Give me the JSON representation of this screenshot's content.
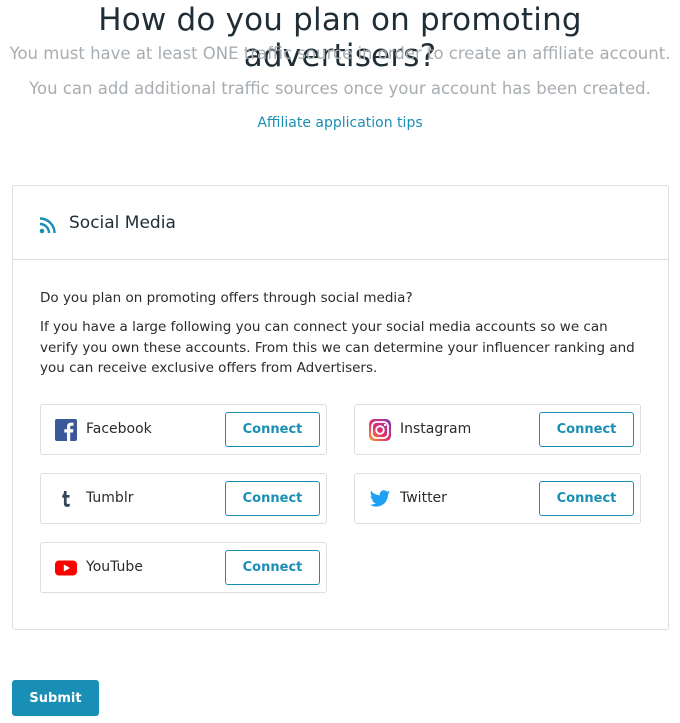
{
  "header": {
    "title": "How do you plan on promoting advertisers?",
    "subtitle_1": "You must have at least ONE traffic source in order to create an affiliate account.",
    "subtitle_2": "You can add additional traffic sources once your account has been created.",
    "tips_link": "Affiliate application tips"
  },
  "panel": {
    "title": "Social Media",
    "icon": "rss-icon",
    "question": "Do you plan on promoting offers through social media?",
    "description": "If you have a large following you can connect your social media accounts so we can verify you own these accounts. From this we can determine your influencer ranking and you can receive exclusive offers from Advertisers.",
    "networks": [
      {
        "label": "Facebook",
        "icon": "facebook-icon",
        "button": "Connect",
        "color": "#3b5998"
      },
      {
        "label": "Instagram",
        "icon": "instagram-icon",
        "button": "Connect",
        "color": "#c13584"
      },
      {
        "label": "Tumblr",
        "icon": "tumblr-icon",
        "button": "Connect",
        "color": "#35465c"
      },
      {
        "label": "Twitter",
        "icon": "twitter-icon",
        "button": "Connect",
        "color": "#1da1f2"
      },
      {
        "label": "YouTube",
        "icon": "youtube-icon",
        "button": "Connect",
        "color": "#ff0000"
      }
    ]
  },
  "submit_label": "Submit",
  "colors": {
    "accent": "#1a8fb5",
    "border": "#dcdfe2",
    "heading": "#1f2d36",
    "muted": "#a8adb1"
  }
}
